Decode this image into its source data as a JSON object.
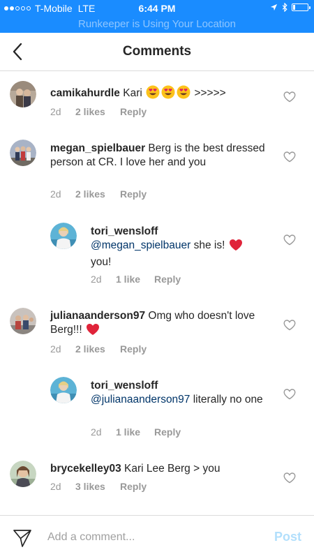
{
  "status_bar": {
    "carrier": "T-Mobile",
    "network": "LTE",
    "time": "6:44 PM",
    "signal_dots_on": 2,
    "signal_dots_total": 5,
    "battery_level": 0.1
  },
  "banner": {
    "text": "Runkeeper is Using Your Location"
  },
  "nav": {
    "title": "Comments",
    "back_icon": "chevron-left-icon"
  },
  "comments": [
    {
      "username": "camikahurdle",
      "text": "Kari",
      "emoji": [
        "heart-eyes",
        "heart-eyes",
        "heart-eyes"
      ],
      "suffix": ">>>>>",
      "time": "2d",
      "likes": "2 likes",
      "reply": "Reply",
      "avatar_color": "#8a7a6a"
    },
    {
      "username": "megan_spielbauer",
      "text": "Berg is the best dressed person at CR. I love her and you",
      "time": "2d",
      "likes": "2 likes",
      "reply": "Reply",
      "avatar_color": "#6a7a90"
    },
    {
      "username": "tori_wensloff",
      "mention": "@megan_spielbauer",
      "text": "she is!",
      "heart_emoji": true,
      "text_after": "you!",
      "time": "2d",
      "likes": "1 like",
      "reply": "Reply",
      "avatar_color": "#4aa0c8",
      "is_reply": true
    },
    {
      "username": "julianaanderson97",
      "text": "Omg who doesn't love Berg!!!",
      "heart_emoji": true,
      "time": "2d",
      "likes": "2 likes",
      "reply": "Reply",
      "avatar_color": "#8c6a5a"
    },
    {
      "username": "tori_wensloff",
      "mention": "@julianaanderson97",
      "text": "literally no one",
      "time": "2d",
      "likes": "1 like",
      "reply": "Reply",
      "avatar_color": "#4aa0c8",
      "is_reply": true
    },
    {
      "username": "brycekelley03",
      "text": "Kari Lee Berg > you",
      "time": "2d",
      "likes": "3 likes",
      "reply": "Reply",
      "avatar_color": "#7a6a5e"
    }
  ],
  "composer": {
    "placeholder": "Add a comment...",
    "post_label": "Post",
    "send_icon": "paper-plane-icon"
  },
  "colors": {
    "status_blue": "#1a8cff",
    "text_dark": "#262626",
    "meta_gray": "#999999",
    "mention_blue": "#003569",
    "post_disabled": "#b2dffc"
  }
}
